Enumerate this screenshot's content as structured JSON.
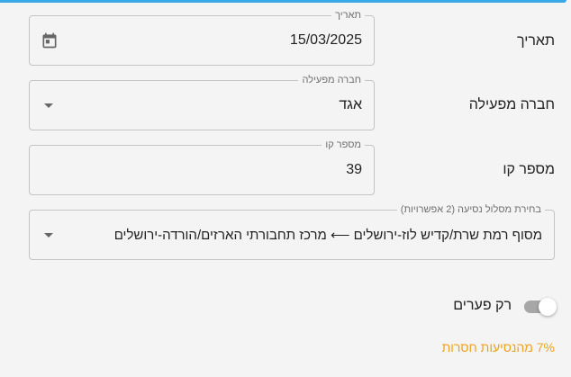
{
  "form": {
    "date": {
      "label": "תאריך",
      "floating_label": "תאריך",
      "value": "15/03/2025",
      "icon": "calendar-icon"
    },
    "operator": {
      "label": "חברה מפעילה",
      "floating_label": "חברה מפעילה",
      "value": "אגד",
      "icon": "dropdown-caret-icon"
    },
    "line": {
      "label": "מספר קו",
      "floating_label": "מספר קו",
      "value": "39"
    },
    "route": {
      "floating_label": "בחירת מסלול נסיעה (2 אפשרויות)",
      "value": "מסוף רמת שרת/קדיש לוז-ירושלים ⟵ מרכז תחבורתי הארזים/הורדה-ירושלים",
      "icon": "dropdown-caret-icon"
    },
    "gaps_toggle": {
      "label": "רק פערים",
      "checked": true
    }
  },
  "status": {
    "missing_rides_text": "7% מהנסיעות חסרות",
    "missing_rides_percent": 7,
    "color": "#f0a21c"
  },
  "colors": {
    "accent": "#3aa8e6",
    "background": "#f4f4f4",
    "border": "#c4c4c4"
  }
}
